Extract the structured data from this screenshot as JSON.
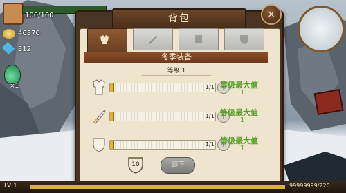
{
  "player": {
    "hp": "100/100",
    "gold": "46370",
    "gems": "312",
    "potion_count": "×1",
    "level": "LV 1",
    "xp": "99999999/220"
  },
  "panel": {
    "title": "背包",
    "close_label": "×",
    "section_title": "冬季装备",
    "level_label": "等级 1",
    "gear_count": "10",
    "confirm_label": "卸下"
  },
  "tabs": [
    {
      "name": "all",
      "active": true
    },
    {
      "name": "weapon",
      "active": false
    },
    {
      "name": "armor",
      "active": false
    },
    {
      "name": "shield",
      "active": false
    }
  ],
  "equipment": [
    {
      "slot": "armor",
      "progress_text": "1/1",
      "progress": 0.03,
      "max_label": "等级最大值",
      "max_sub": "1"
    },
    {
      "slot": "sword",
      "progress_text": "1/1",
      "progress": 0.03,
      "max_label": "等级最大值",
      "max_sub": "1"
    },
    {
      "slot": "shield",
      "progress_text": "1/1",
      "progress": 0.03,
      "max_label": "等级最大值",
      "max_sub": "1"
    }
  ],
  "colors": {
    "accent_green": "#58a12a",
    "panel_brown": "#4a3322",
    "gold": "#e1b233"
  }
}
